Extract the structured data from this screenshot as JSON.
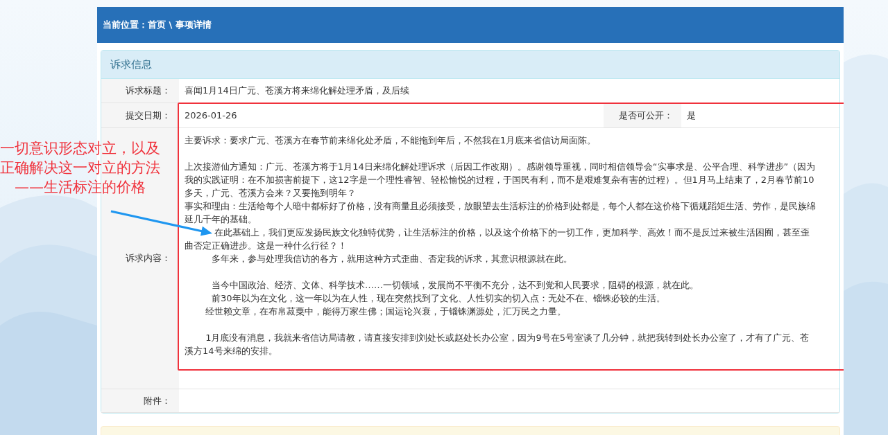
{
  "breadcrumb": "当前位置：首页 \\ 事项详情",
  "panel": {
    "title": "诉求信息",
    "rows": [
      {
        "kind": "text",
        "label": "诉求标题：",
        "value": "喜闻1月14日广元、苍溪方将来绵化解处理矛盾，及后续"
      },
      {
        "kind": "pair",
        "label": "提交日期：",
        "value": "2026-01-26",
        "label_2": "是否可公开：",
        "value_2": "是"
      },
      {
        "kind": "content",
        "label": "诉求内容：",
        "groups": [
          [
            "主要诉求：要求广元、苍溪方在春节前来绵化处矛盾，不能拖到年后，不然我在1月底来省信访局面陈。"
          ],
          [
            "上次接游仙方通知：广元、苍溪方将于1月14日来绵化解处理诉求（后因工作改期）。感谢领导重视，同时相信领导会“实事求是、公平合理、科学进步”（因为我的实践证明：在不加损害前提下，这12字是一个理性睿智、轻松愉悦的过程，于国民有利，而不是艰难复杂有害的过程）。但1月马上结束了，2月春节前10多天，广元、苍溪方会来？又要拖到明年？",
            "事实和理由：生活给每个人暗中都标好了价格，没有商量且必须接受，放眼望去生活标注的价格到处都是，每个人都在这价格下循规蹈矩生活、劳作，是民族绵延几千年的基础。",
            "　　　 在此基础上，我们更应发扬民族文化独特优势，让生活标注的价格，以及这个价格下的一切工作，更加科学、高效！而不是反过来被生活困囿，甚至歪曲否定正确进步。这是一种什么行径？！",
            "　　　多年来，参与处理我信访的各方，就用这种方式歪曲、否定我的诉求，其意识根源就在此。"
          ],
          [
            "　　　当今中国政治、经济、文体、科学技术……一切领域，发展尚不平衡不充分，达不到党和人民要求，阻碍的根源，就在此。",
            "　　　前30年以为在文化，这一年以为在人性，现在突然找到了文化、人性切实的切入点：无处不在、锱铢必较的生活。",
            "　　 经世赖文章，在布帛菽粟中，能得万家生佛；国运论兴衰，于锱铢渊源处，汇万民之力量。"
          ],
          [
            "　　 1月底没有消息，我就来省信访局请教，请直接安排到刘处长或赵处长办公室，因为9号在5号室谈了几分钟，就把我转到处长办公室了，才有了广元、苍溪方14号来绵的安排。"
          ]
        ]
      },
      {
        "kind": "empty",
        "label": "附件："
      }
    ]
  },
  "annotation": {
    "lines": [
      "一切意识形态对立，以及",
      "正确解决这一对立的方法",
      "——生活标注的价格"
    ]
  }
}
